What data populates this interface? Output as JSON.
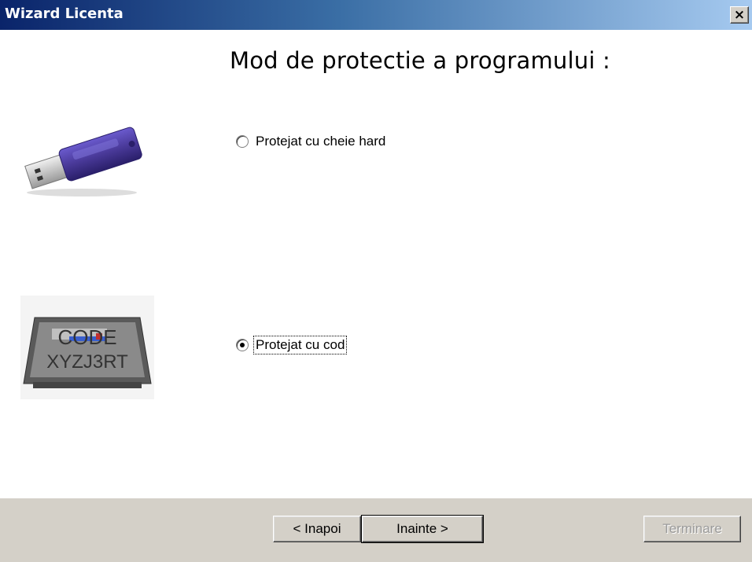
{
  "window": {
    "title": "Wizard Licenta",
    "close_label": "×"
  },
  "main": {
    "heading": "Mod de protectie a programului :",
    "options": [
      {
        "label": "Protejat cu cheie hard",
        "checked": false
      },
      {
        "label": "Protejat cu cod",
        "checked": true
      }
    ],
    "code_image_text": [
      "CODE",
      "XYZJ3RT"
    ]
  },
  "footer": {
    "back_label": "< Inapoi",
    "next_label": "Inainte >",
    "finish_label": "Terminare"
  },
  "colors": {
    "titlebar_start": "#0a246a",
    "titlebar_end": "#a6caf0",
    "dialog_face": "#d4d0c8",
    "usb_body": "#4a3a9a"
  }
}
